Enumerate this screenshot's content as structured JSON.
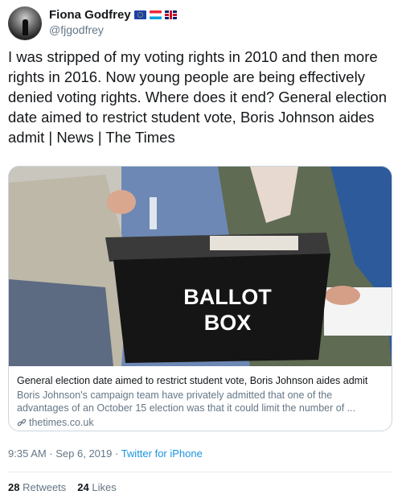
{
  "user": {
    "display_name": "Fiona Godfrey",
    "handle": "@fjgodfrey",
    "flags": [
      "eu-flag-icon",
      "luxembourg-flag-icon",
      "uk-flag-icon"
    ]
  },
  "tweet": {
    "text": "I was stripped of my voting rights in 2010 and then more rights in 2016. Now young people are being effectively denied voting rights. Where does it end? General election date aimed to restrict student vote, Boris Johnson aides admit | News | The Times"
  },
  "card": {
    "image_text_line1": "BALLOT",
    "image_text_line2": "BOX",
    "title": "General election date aimed to restrict student vote, Boris Johnson aides admit",
    "description": "Boris Johnson's campaign team have privately admitted that one of the advantages of an October 15 election was that it could limit the number of ...",
    "domain": "thetimes.co.uk"
  },
  "meta": {
    "timestamp": "9:35 AM · Sep 6, 2019 · ",
    "source": "Twitter for iPhone"
  },
  "stats": {
    "retweets_count": "28",
    "retweets_label": "Retweets",
    "likes_count": "24",
    "likes_label": "Likes"
  },
  "colors": {
    "link_blue": "#1b95e0",
    "secondary_text": "#657786",
    "border": "#ccd6dd"
  }
}
